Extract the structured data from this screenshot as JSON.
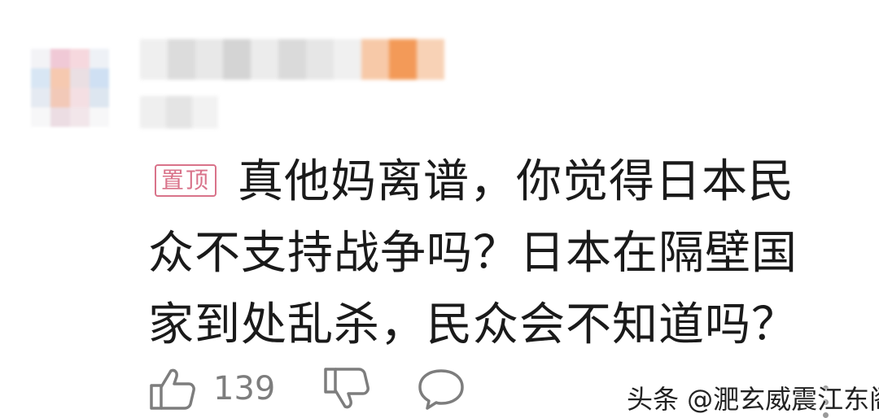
{
  "comment": {
    "pin_badge_label": "置顶",
    "text": "真他妈离谱，你觉得日本民众不支持战争吗？日本在隔壁国家到处乱杀，民众会不知道吗？",
    "like_count": "139",
    "icons": {
      "like": "thumbs-up-icon",
      "dislike": "thumbs-down-icon",
      "reply": "speech-bubble-icon",
      "more": "more-vertical-icon"
    }
  },
  "watermark": {
    "text": "头条 @淝玄威震江东阁"
  },
  "colors": {
    "pin_badge": "#d9738a",
    "icon_gray": "#7d7d7d",
    "text": "#1a1a1a"
  }
}
